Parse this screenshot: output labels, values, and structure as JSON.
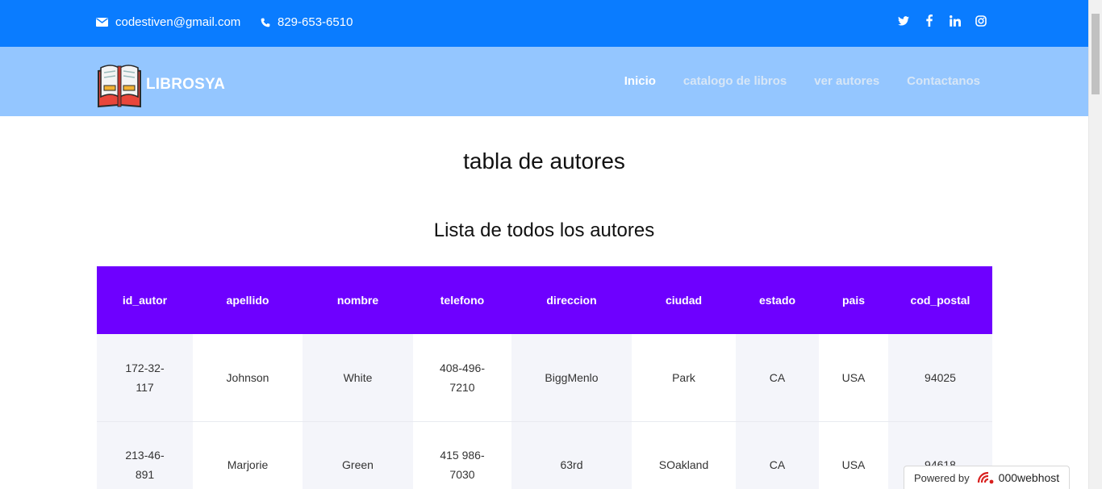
{
  "topbar": {
    "email": "codestiven@gmail.com",
    "phone": "829-653-6510",
    "socials": [
      "twitter-icon",
      "facebook-icon",
      "linkedin-icon",
      "instagram-icon"
    ],
    "background": "#0a7cff"
  },
  "navbar": {
    "brand": "LIBROSYA",
    "background": "#94c6ff",
    "links": [
      {
        "label": "Inicio",
        "active": true
      },
      {
        "label": "catalogo de libros",
        "active": false
      },
      {
        "label": "ver autores",
        "active": false
      },
      {
        "label": "Contactanos",
        "active": false
      }
    ]
  },
  "main": {
    "title": "tabla de autores",
    "subtitle": "Lista de todos los autores"
  },
  "table": {
    "header_color": "#6e00ff",
    "columns": [
      "id_autor",
      "apellido",
      "nombre",
      "telefono",
      "direccion",
      "ciudad",
      "estado",
      "pais",
      "cod_postal"
    ],
    "rows": [
      [
        "172-32-117",
        "Johnson",
        "White",
        "408-496-7210",
        "BiggMenlo",
        "Park",
        "CA",
        "USA",
        "94025"
      ],
      [
        "213-46-891",
        "Marjorie",
        "Green",
        "415 986-7030",
        "63rd",
        "SOakland",
        "CA",
        "USA",
        "94618"
      ]
    ]
  },
  "badge": {
    "powered_label": "Powered by",
    "brand": "000webhost"
  }
}
